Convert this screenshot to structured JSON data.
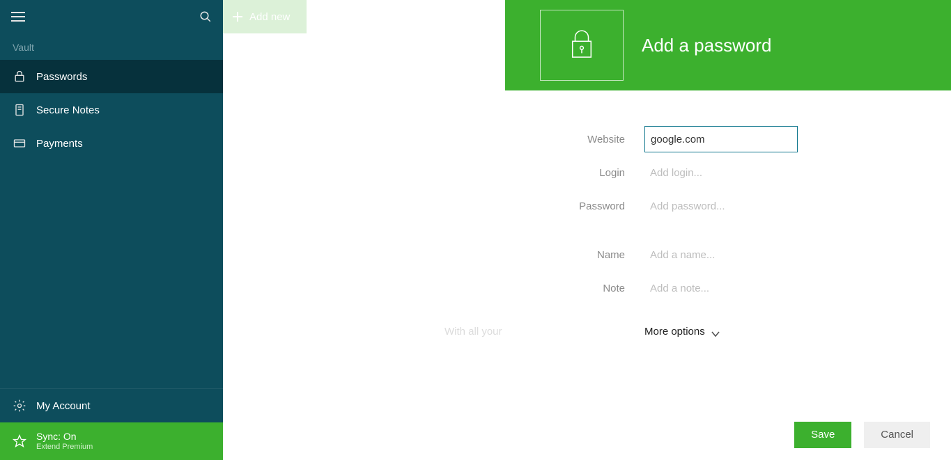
{
  "colors": {
    "accent": "#3cb02e",
    "sidebar": "#0d4d5c",
    "sidebar_active": "#06313c"
  },
  "sidebar": {
    "section_label": "Vault",
    "items": [
      {
        "icon": "lock-icon",
        "label": "Passwords",
        "active": true
      },
      {
        "icon": "note-icon",
        "label": "Secure Notes",
        "active": false
      },
      {
        "icon": "card-icon",
        "label": "Payments",
        "active": false
      }
    ],
    "account_label": "My Account",
    "sync": {
      "title": "Sync: On",
      "sub": "Extend Premium"
    }
  },
  "middle": {
    "addnew_label": "Add new",
    "watermark": "With all your"
  },
  "panel": {
    "title": "Add a password",
    "fields": {
      "website": {
        "label": "Website",
        "value": "google.com",
        "placeholder": ""
      },
      "login": {
        "label": "Login",
        "value": "",
        "placeholder": "Add login..."
      },
      "password": {
        "label": "Password",
        "value": "",
        "placeholder": "Add password..."
      },
      "name": {
        "label": "Name",
        "value": "",
        "placeholder": "Add a name..."
      },
      "note": {
        "label": "Note",
        "value": "",
        "placeholder": "Add a note..."
      }
    },
    "more_options_label": "More options",
    "buttons": {
      "save": "Save",
      "cancel": "Cancel"
    }
  }
}
